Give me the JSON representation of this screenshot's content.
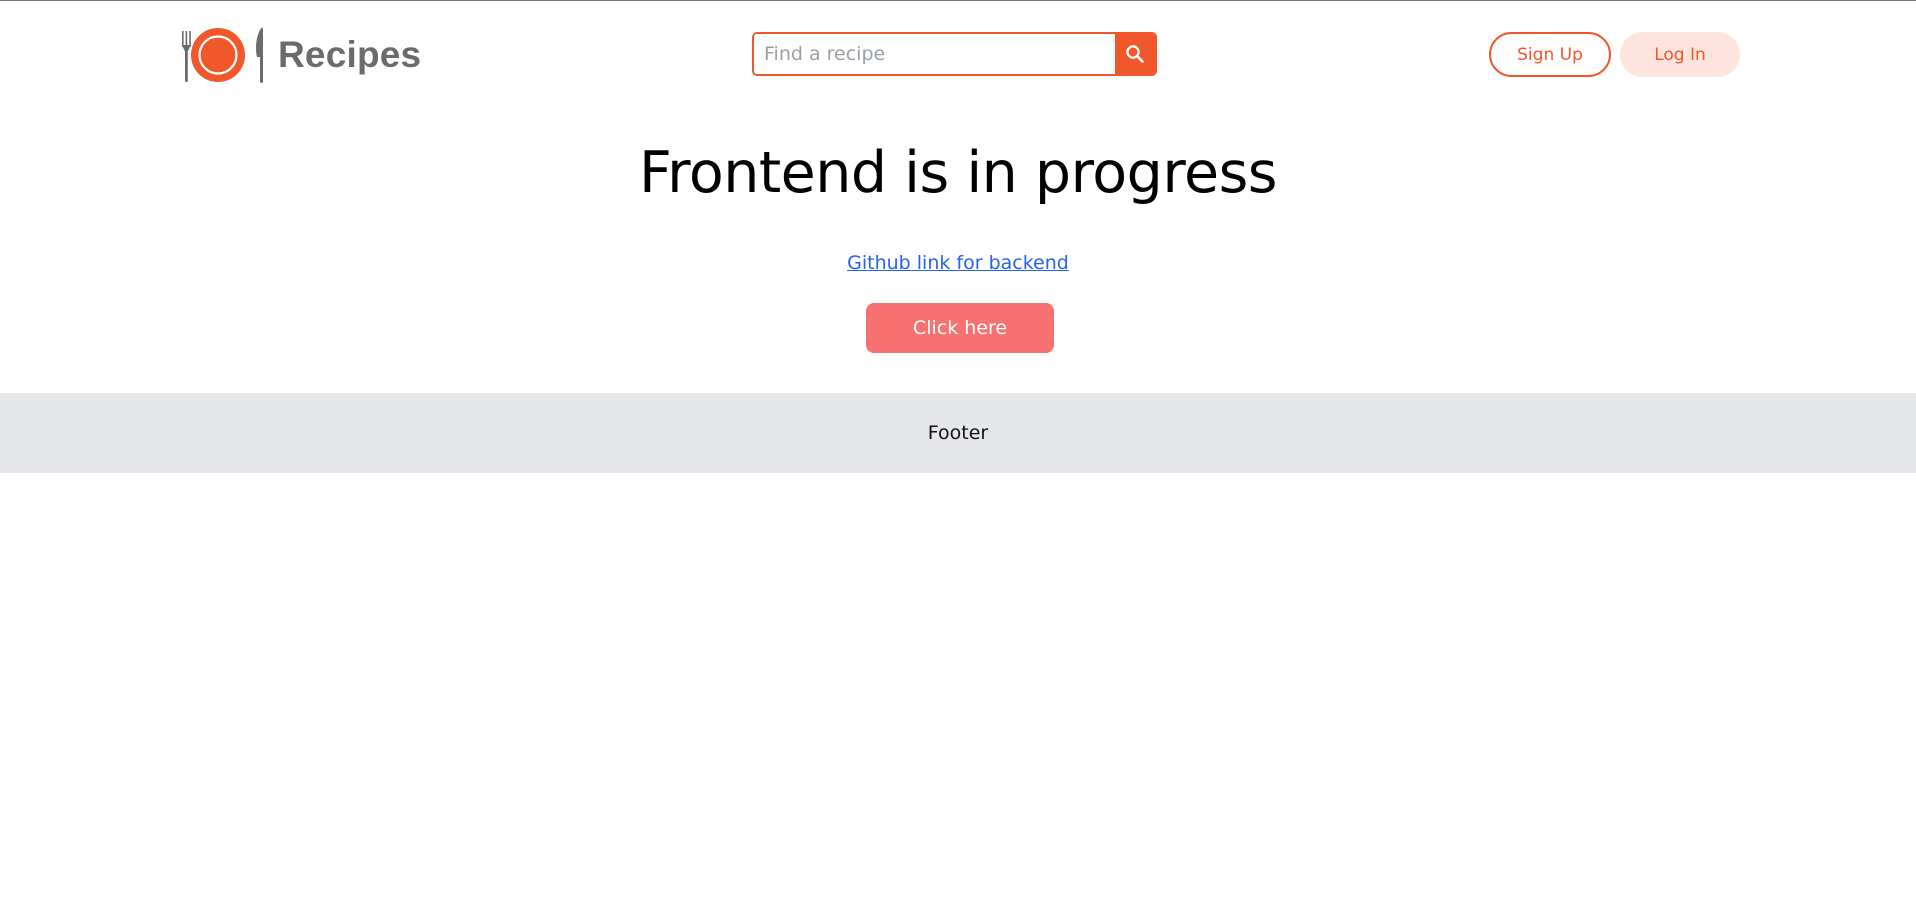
{
  "brand": {
    "name": "Recipes",
    "accent_color": "#f0572a",
    "icon": "plate-fork-knife-icon"
  },
  "search": {
    "placeholder": "Find a recipe",
    "value": "",
    "button_icon": "search-icon"
  },
  "auth": {
    "signup_label": "Sign Up",
    "login_label": "Log In"
  },
  "main": {
    "title": "Frontend is in progress",
    "link_text": "Github link for backend",
    "cta_label": "Click here",
    "cta_color": "#f87171"
  },
  "footer": {
    "text": "Footer",
    "background": "#e5e7eb"
  }
}
